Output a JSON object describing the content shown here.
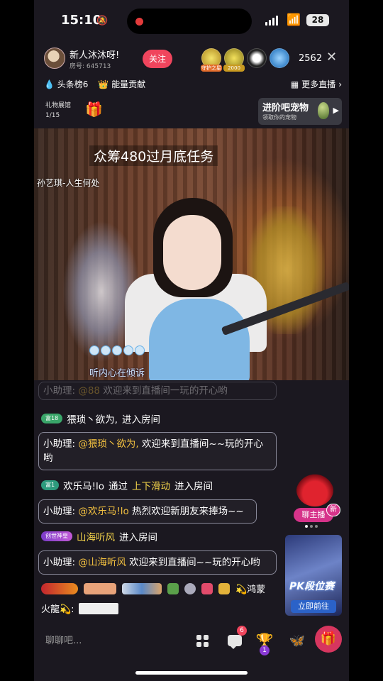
{
  "status": {
    "time": "15:10",
    "battery": "28"
  },
  "header": {
    "host_name": "新人沐沐呀!",
    "room_label": "房号:",
    "room_id": "645713",
    "follow_label": "关注",
    "viewer_tags": [
      "守护之星",
      "2000"
    ],
    "viewer_count": "2562",
    "headline_rank": "头条榜6",
    "energy_label": "能量贡献",
    "more_live": "更多直播",
    "gift_hall": "礼物展馆",
    "gift_hall_progress": "1/15"
  },
  "pet_banner": {
    "title": "进阶吧宠物",
    "subtitle": "领取你的宠物"
  },
  "video": {
    "goal_title": "众筹480过月底任务",
    "song": "孙艺琪-人生何处",
    "caption": "听内心在倾诉"
  },
  "chat": [
    {
      "prefix": "小助理: ",
      "mention": "@88",
      "text": "欢迎来到直播间一玩的开心哟"
    },
    {
      "badge": "富18",
      "user": "猥琐丶欲为,",
      "action": "进入房间"
    },
    {
      "prefix": "小助理: ",
      "mention": "@猥琐丶欲为,",
      "text": "欢迎来到直播间~~玩的开心哟"
    },
    {
      "badge": "富1",
      "user": "欢乐马!lo",
      "via": "通过",
      "method": "上下滑动",
      "action": "进入房间"
    },
    {
      "prefix": "小助理: ",
      "mention": "@欢乐马!lo",
      "text": "热烈欢迎新朋友来捧场~~"
    },
    {
      "badge": "创世神皇",
      "user": "山海听风",
      "action": "进入房间"
    },
    {
      "prefix": "小助理: ",
      "mention": "@山海听风",
      "text": "欢迎来到直播间~~玩的开心哟"
    }
  ],
  "gift_feed": {
    "user_part1": "💫鸿蒙",
    "user_part2": "火龍💫:"
  },
  "side": {
    "talk_label": "聊主播",
    "new_label": "新",
    "pk_title": "PK段位赛",
    "pk_button": "立即前往"
  },
  "bottom": {
    "input_placeholder": "聊聊吧...",
    "msg_count": "6",
    "fan_level": "1"
  }
}
